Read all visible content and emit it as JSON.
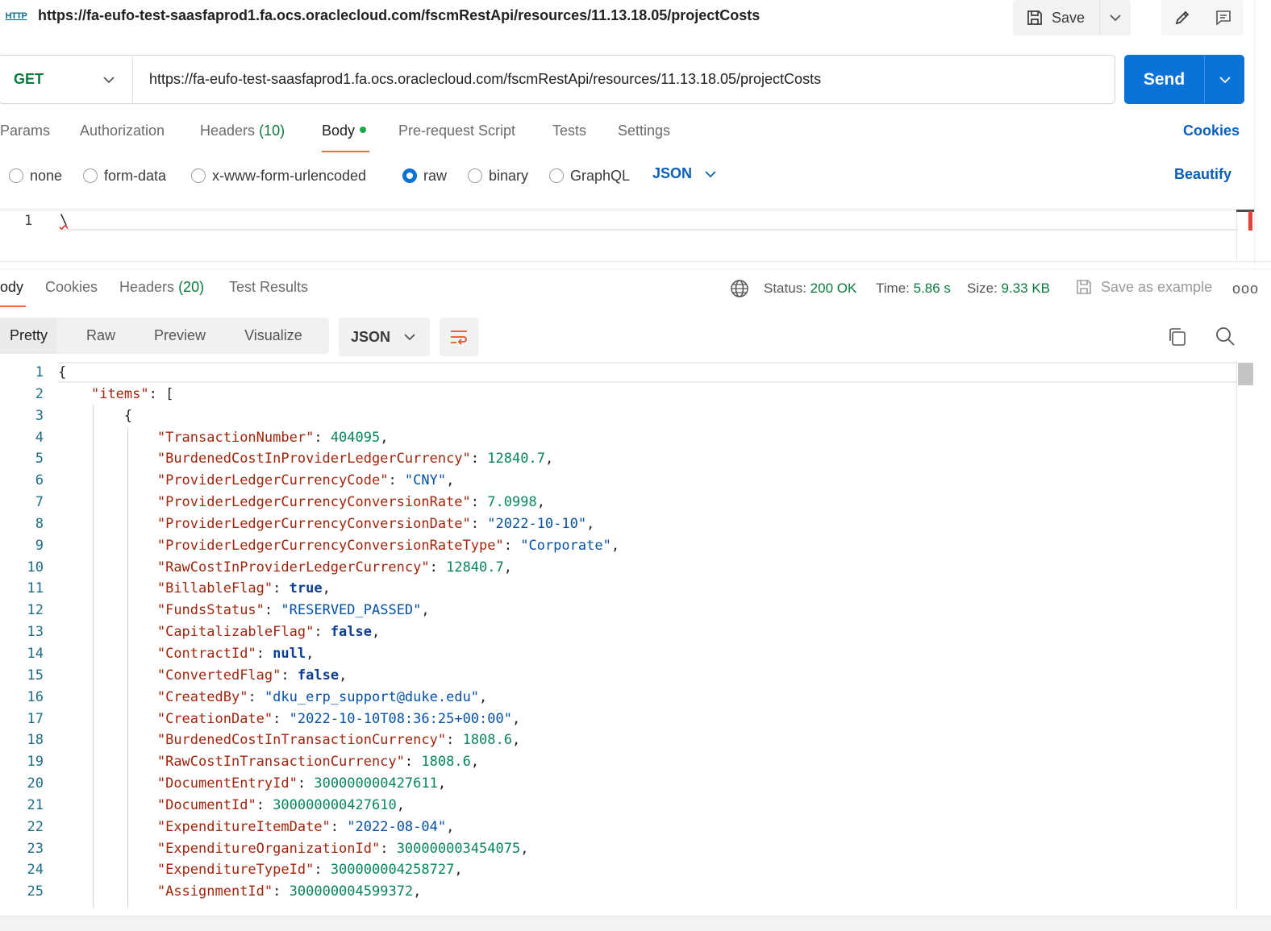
{
  "tab_title_url": "https://fa-eufo-test-saasfaprod1.fa.ocs.oraclecloud.com/fscmRestApi/resources/11.13.18.05/projectCosts",
  "http_badge": "HTTP",
  "toolbar": {
    "save_label": "Save"
  },
  "request": {
    "method": "GET",
    "url": "https://fa-eufo-test-saasfaprod1.fa.ocs.oraclecloud.com/fscmRestApi/resources/11.13.18.05/projectCosts",
    "send_label": "Send"
  },
  "request_tabs": {
    "params": "Params",
    "authorization": "Authorization",
    "headers": "Headers",
    "headers_count": "(10)",
    "body": "Body",
    "prerequest": "Pre-request Script",
    "tests": "Tests",
    "settings": "Settings",
    "cookies": "Cookies"
  },
  "body_types": {
    "none": "none",
    "form_data": "form-data",
    "urlencoded": "x-www-form-urlencoded",
    "raw": "raw",
    "binary": "binary",
    "graphql": "GraphQL",
    "selected": "raw",
    "format": "JSON",
    "beautify": "Beautify"
  },
  "request_editor": {
    "line_number": "1",
    "content": "\\"
  },
  "response_tabs": {
    "body": "ody",
    "cookies": "Cookies",
    "headers": "Headers",
    "headers_count": "(20)",
    "test_results": "Test Results"
  },
  "response_status": {
    "status_label": "Status:",
    "status_value": "200 OK",
    "time_label": "Time:",
    "time_value": "5.86 s",
    "size_label": "Size:",
    "size_value": "9.33 KB",
    "save_example": "Save as example",
    "more": "ooo"
  },
  "view_modes": {
    "pretty": "Pretty",
    "raw": "Raw",
    "preview": "Preview",
    "visualize": "Visualize",
    "format": "JSON"
  },
  "response_lines": [
    {
      "n": "1",
      "t": "{"
    },
    {
      "n": "2",
      "key": "items",
      "rest": "["
    },
    {
      "n": "3",
      "t": "{"
    },
    {
      "n": "4",
      "key": "TransactionNumber",
      "num": "404095"
    },
    {
      "n": "5",
      "key": "BurdenedCostInProviderLedgerCurrency",
      "num": "12840.7"
    },
    {
      "n": "6",
      "key": "ProviderLedgerCurrencyCode",
      "str": "\"CNY\""
    },
    {
      "n": "7",
      "key": "ProviderLedgerCurrencyConversionRate",
      "num": "7.0998"
    },
    {
      "n": "8",
      "key": "ProviderLedgerCurrencyConversionDate",
      "str": "\"2022-10-10\""
    },
    {
      "n": "9",
      "key": "ProviderLedgerCurrencyConversionRateType",
      "str": "\"Corporate\""
    },
    {
      "n": "10",
      "key": "RawCostInProviderLedgerCurrency",
      "num": "12840.7"
    },
    {
      "n": "11",
      "key": "BillableFlag",
      "bool": "true"
    },
    {
      "n": "12",
      "key": "FundsStatus",
      "str": "\"RESERVED_PASSED\""
    },
    {
      "n": "13",
      "key": "CapitalizableFlag",
      "bool": "false"
    },
    {
      "n": "14",
      "key": "ContractId",
      "bool": "null"
    },
    {
      "n": "15",
      "key": "ConvertedFlag",
      "bool": "false"
    },
    {
      "n": "16",
      "key": "CreatedBy",
      "str": "\"dku_erp_support@duke.edu\""
    },
    {
      "n": "17",
      "key": "CreationDate",
      "str": "\"2022-10-10T08:36:25+00:00\""
    },
    {
      "n": "18",
      "key": "BurdenedCostInTransactionCurrency",
      "num": "1808.6"
    },
    {
      "n": "19",
      "key": "RawCostInTransactionCurrency",
      "num": "1808.6"
    },
    {
      "n": "20",
      "key": "DocumentEntryId",
      "num": "300000000427611"
    },
    {
      "n": "21",
      "key": "DocumentId",
      "num": "300000000427610"
    },
    {
      "n": "22",
      "key": "ExpenditureItemDate",
      "str": "\"2022-08-04\""
    },
    {
      "n": "23",
      "key": "ExpenditureOrganizationId",
      "num": "300000003454075"
    },
    {
      "n": "24",
      "key": "ExpenditureTypeId",
      "num": "300000004258727"
    },
    {
      "n": "25",
      "key": "AssignmentId",
      "num": "300000004599372"
    }
  ]
}
